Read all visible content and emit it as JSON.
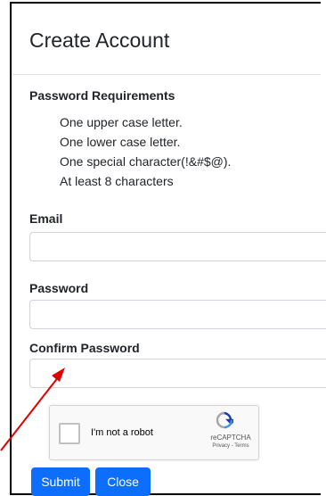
{
  "header": {
    "title": "Create Account"
  },
  "requirements": {
    "heading": "Password Requirements",
    "items": [
      "One upper case letter.",
      "One lower case letter.",
      "One special character(!&#$@).",
      "At least 8 characters"
    ]
  },
  "form": {
    "email_label": "Email",
    "email_value": "",
    "password_label": "Password",
    "password_value": "",
    "confirm_label": "Confirm Password",
    "confirm_value": ""
  },
  "recaptcha": {
    "label": "I'm not a robot",
    "brand": "reCAPTCHA",
    "terms": "Privacy - Terms",
    "checked": false,
    "icon": "recaptcha-logo-icon"
  },
  "buttons": {
    "submit": "Submit",
    "close": "Close"
  },
  "colors": {
    "primary": "#0d6efd",
    "annotation_arrow": "#e00000"
  }
}
